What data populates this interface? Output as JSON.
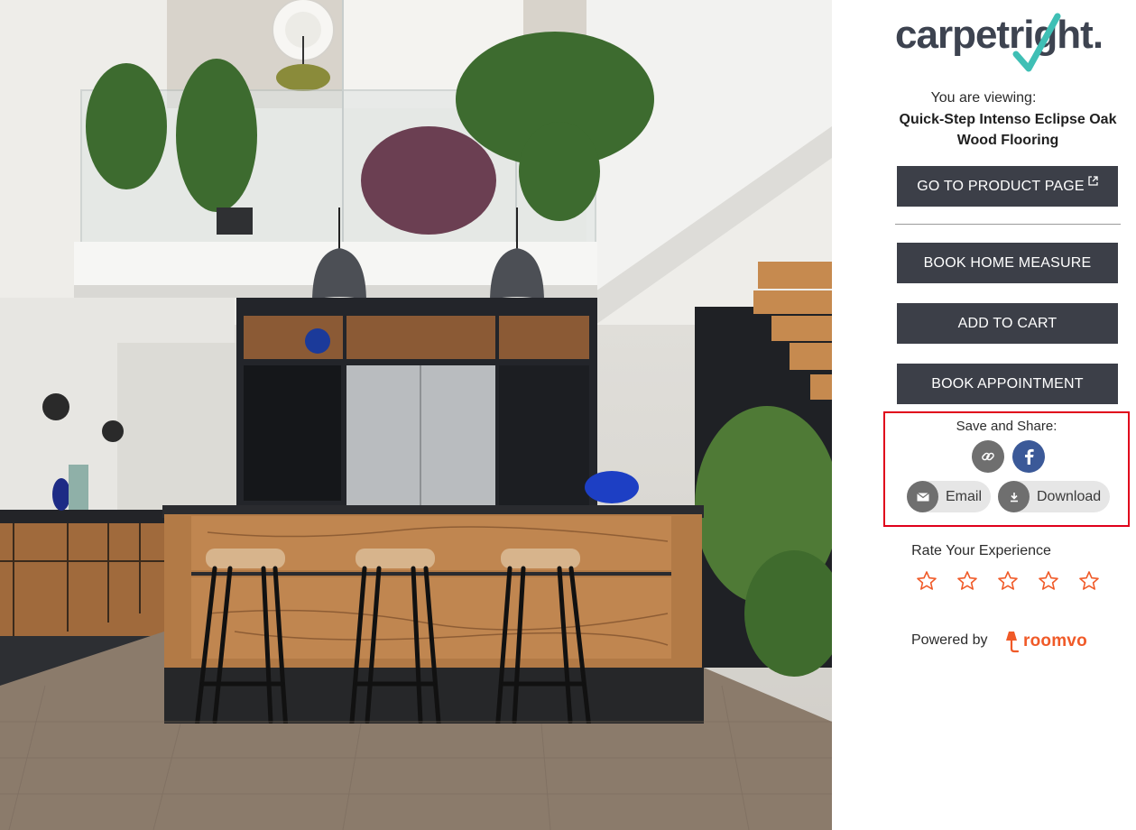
{
  "scene": {
    "description_icon": "room-visualizer-kitchen"
  },
  "brand": {
    "logo_text": "carpetright.",
    "logo_color": "#3d4350",
    "tick_color": "#3fbfb5"
  },
  "viewing": {
    "label": "You are viewing:",
    "product_line1": "Quick-Step Intenso Eclipse Oak",
    "product_line2": "Wood Flooring"
  },
  "buttons": {
    "product_page": "GO TO PRODUCT PAGE",
    "book_measure": "BOOK HOME MEASURE",
    "add_to_cart": "ADD TO CART",
    "book_appointment": "BOOK APPOINTMENT",
    "button_color": "#3c3f48"
  },
  "share": {
    "title": "Save and Share:",
    "link_icon": "link-icon",
    "facebook_icon": "facebook-icon",
    "facebook_color": "#3b5998",
    "email_label": "Email",
    "download_label": "Download",
    "highlight_color": "#e0001b"
  },
  "rating": {
    "title": "Rate Your Experience",
    "stars": 5,
    "selected": 0,
    "star_color": "#f05a28"
  },
  "powered": {
    "label": "Powered by",
    "brand": "roomvo",
    "brand_color": "#f05a28"
  }
}
